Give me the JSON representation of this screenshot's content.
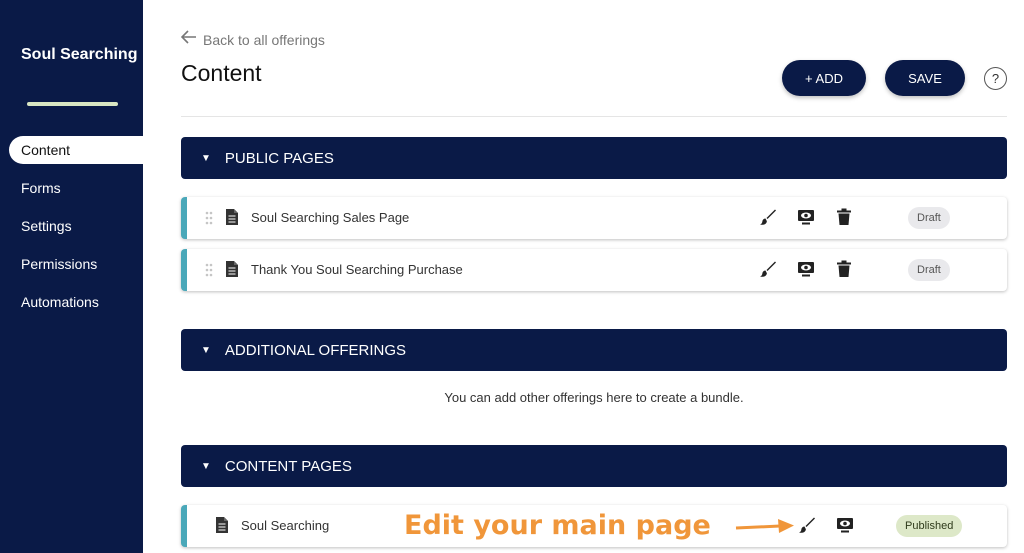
{
  "sidebar": {
    "brand": "Soul Searching",
    "items": [
      {
        "label": "Content",
        "active": true
      },
      {
        "label": "Forms"
      },
      {
        "label": "Settings"
      },
      {
        "label": "Permissions"
      },
      {
        "label": "Automations"
      }
    ]
  },
  "header": {
    "back_label": "Back to all offerings",
    "title": "Content",
    "add_label": "+ ADD",
    "save_label": "SAVE",
    "help_label": "?"
  },
  "sections": {
    "public": {
      "title": "PUBLIC PAGES"
    },
    "additional": {
      "title": "ADDITIONAL OFFERINGS",
      "note": "You can add other offerings here to create a bundle."
    },
    "content": {
      "title": "CONTENT PAGES"
    }
  },
  "rows": {
    "public": [
      {
        "label": "Soul Searching Sales Page",
        "status": "Draft"
      },
      {
        "label": "Thank You Soul Searching Purchase",
        "status": "Draft"
      }
    ],
    "content": [
      {
        "label": "Soul Searching",
        "status": "Published"
      }
    ]
  },
  "annotation": {
    "text": "Edit your main page"
  },
  "colors": {
    "navy": "#0a1a47",
    "accent_teal": "#4aa8b9",
    "annotation_orange": "#f0963a",
    "published_bg": "#dde8c8",
    "draft_bg": "#e9e9ec"
  }
}
